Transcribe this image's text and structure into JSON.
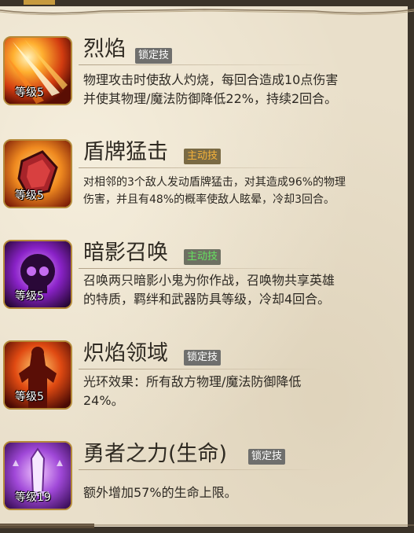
{
  "skills": [
    {
      "name": "烈焰",
      "tag": "锁定技",
      "tag_type": "locked",
      "level": "等级5",
      "icon": "fire-slash-icon",
      "desc_lines": [
        "物理攻击时使敌人灼烧，每回合造成10点伤害",
        "并使其物理/魔法防御降低22%，持续2回合。"
      ]
    },
    {
      "name": "盾牌猛击",
      "tag": "主动技",
      "tag_type": "active",
      "level": "等级5",
      "icon": "shield-bash-icon",
      "desc_lines": [
        "对相邻的3个敌人发动盾牌猛击，对其造成96%的物理",
        "伤害，并且有48%的概率使敌人眩晕，冷却3回合。"
      ]
    },
    {
      "name": "暗影召唤",
      "tag": "主动技",
      "tag_type": "active",
      "level": "等级5",
      "icon": "skull-summon-icon",
      "desc_lines": [
        "召唤两只暗影小鬼为你作战，召唤物共享英雄",
        "的特质，羁绊和武器防具等级，冷却4回合。"
      ]
    },
    {
      "name": "炽焰领域",
      "tag": "锁定技",
      "tag_type": "locked",
      "level": "等级5",
      "icon": "flame-aura-icon",
      "desc_lines": [
        "光环效果：所有敌方物理/魔法防御降低",
        "24%。"
      ]
    },
    {
      "name": "勇者之力(生命)",
      "tag": "锁定技",
      "tag_type": "locked",
      "level": "等级19",
      "icon": "hero-sword-icon",
      "desc_lines": [
        "额外增加57%的生命上限。"
      ]
    }
  ],
  "colors": {
    "parchment": "#e9dfca",
    "text": "#2d2923",
    "tag_locked_bg": "#6f6f6d",
    "tag_active_orange": "#f5b23a",
    "tag_active_green": "#66e060",
    "frame_gold": "#b58a3a"
  }
}
